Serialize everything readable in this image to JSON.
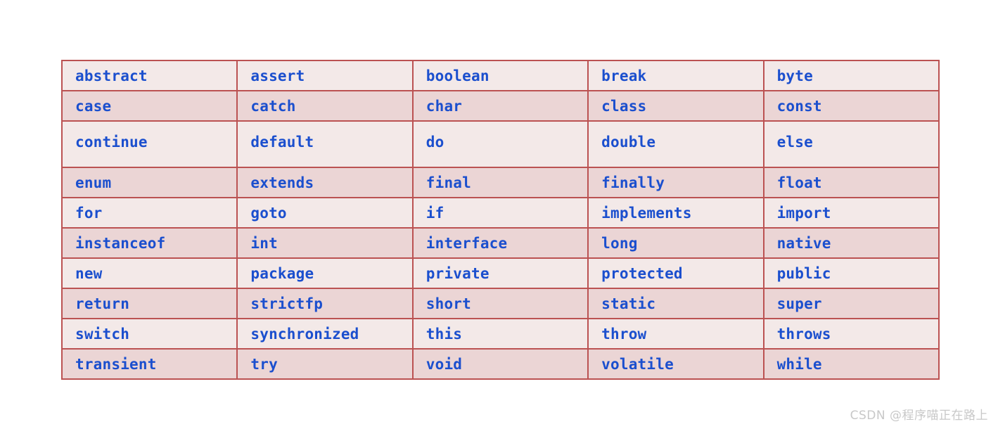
{
  "table": {
    "columns": 5,
    "rows": [
      {
        "tall": false,
        "cells": [
          "abstract",
          "assert",
          "boolean",
          "break",
          "byte"
        ]
      },
      {
        "tall": false,
        "cells": [
          "case",
          "catch",
          "char",
          "class",
          "const"
        ]
      },
      {
        "tall": true,
        "cells": [
          "continue",
          "default",
          "do",
          "double",
          "else"
        ]
      },
      {
        "tall": false,
        "cells": [
          "enum",
          "extends",
          "final",
          "finally",
          "float"
        ]
      },
      {
        "tall": false,
        "cells": [
          "for",
          "goto",
          "if",
          "implements",
          "import"
        ]
      },
      {
        "tall": false,
        "cells": [
          "instanceof",
          "int",
          "interface",
          "long",
          "native"
        ]
      },
      {
        "tall": false,
        "cells": [
          "new",
          "package",
          "private",
          "protected",
          "public"
        ]
      },
      {
        "tall": false,
        "cells": [
          "return",
          "strictfp",
          "short",
          "static",
          "super"
        ]
      },
      {
        "tall": false,
        "cells": [
          "switch",
          "synchronized",
          "this",
          "throw",
          "throws"
        ]
      },
      {
        "tall": false,
        "cells": [
          "transient",
          "try",
          "void",
          "volatile",
          "while"
        ]
      }
    ]
  },
  "watermark": {
    "text": "CSDN @程序喵正在路上"
  },
  "colors": {
    "border": "#bb5252",
    "row_light": "#f3e9e8",
    "row_dark": "#ebd5d5",
    "keyword_text": "#1b4fce",
    "watermark_text": "#c8c8c8",
    "page_background": "#ffffff"
  }
}
